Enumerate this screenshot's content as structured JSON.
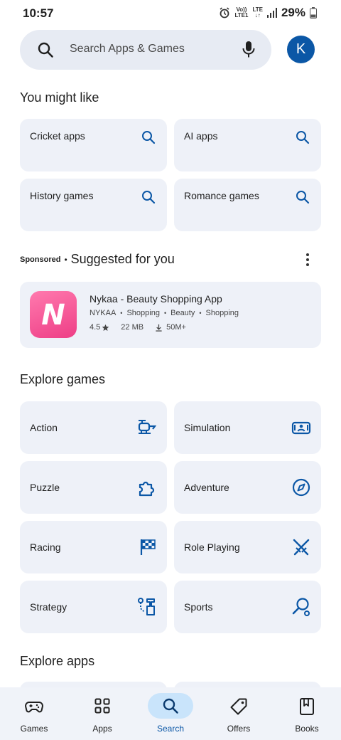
{
  "status_bar": {
    "time": "10:57",
    "volte_top": "Vo))",
    "volte_bottom": "LTE1",
    "lte_top": "LTE",
    "lte_bottom": "↓↑",
    "battery": "29%"
  },
  "search": {
    "placeholder": "Search Apps & Games",
    "avatar_letter": "K"
  },
  "you_might_like": {
    "title": "You might like",
    "chips": [
      {
        "label": "Cricket apps",
        "icon": "search-icon"
      },
      {
        "label": "AI apps",
        "icon": "search-icon"
      },
      {
        "label": "History games",
        "icon": "search-icon"
      },
      {
        "label": "Romance games",
        "icon": "search-icon"
      }
    ]
  },
  "suggested": {
    "sponsored": "Sponsored",
    "dot": "•",
    "title": "Suggested for you",
    "app": {
      "name": "Nykaa - Beauty Shopping App",
      "developer": "NYKAA",
      "tags": [
        "Shopping",
        "Beauty",
        "Shopping"
      ],
      "rating": "4.5",
      "size": "22 MB",
      "downloads": "50M+",
      "icon_letter": "N"
    }
  },
  "explore_games": {
    "title": "Explore games",
    "categories": [
      {
        "label": "Action",
        "icon": "action-helicopter-icon"
      },
      {
        "label": "Simulation",
        "icon": "simulation-icon"
      },
      {
        "label": "Puzzle",
        "icon": "puzzle-icon"
      },
      {
        "label": "Adventure",
        "icon": "compass-icon"
      },
      {
        "label": "Racing",
        "icon": "checkered-flag-icon"
      },
      {
        "label": "Role Playing",
        "icon": "crossed-swords-icon"
      },
      {
        "label": "Strategy",
        "icon": "strategy-icon"
      },
      {
        "label": "Sports",
        "icon": "racket-icon"
      }
    ]
  },
  "explore_apps": {
    "title": "Explore apps"
  },
  "bottom_nav": {
    "items": [
      {
        "label": "Games",
        "icon": "gamepad-icon"
      },
      {
        "label": "Apps",
        "icon": "apps-grid-icon"
      },
      {
        "label": "Search",
        "icon": "search-icon",
        "active": true
      },
      {
        "label": "Offers",
        "icon": "tag-icon"
      },
      {
        "label": "Books",
        "icon": "book-icon"
      }
    ]
  },
  "colors": {
    "accent": "#0b57a6",
    "card_bg": "#eef1f8",
    "search_bg": "#e7ebf3",
    "nav_active_pill": "#c9e4fb"
  }
}
